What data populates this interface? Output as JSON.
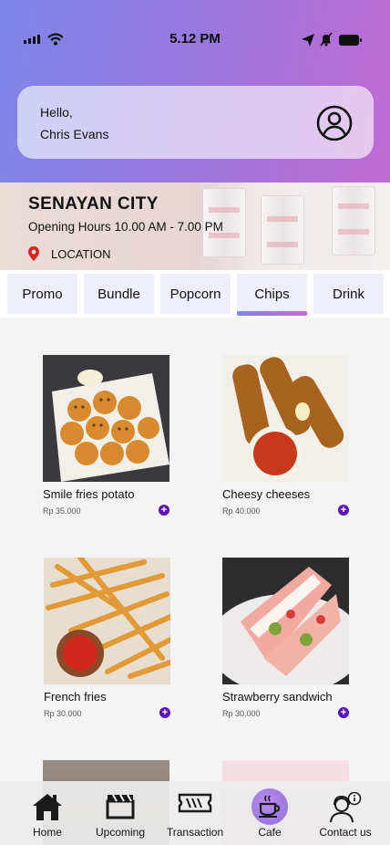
{
  "status_bar": {
    "time": "5.12 PM"
  },
  "greeting": {
    "line1": "Hello,",
    "line2": "Chris Evans"
  },
  "store": {
    "name": "SENAYAN CITY",
    "hours": "Opening Hours 10.00 AM - 7.00 PM",
    "location_label": "LOCATION"
  },
  "tabs": [
    {
      "label": "Promo"
    },
    {
      "label": "Bundle"
    },
    {
      "label": "Popcorn"
    },
    {
      "label": "Chips",
      "active": true
    },
    {
      "label": "Drink"
    }
  ],
  "products": [
    {
      "name": "Smile fries potato",
      "price": "Rp 35.000",
      "icon": "smile-fries-photo"
    },
    {
      "name": "Cheesy cheeses",
      "price": "Rp 40.000",
      "icon": "mozzarella-sticks-photo"
    },
    {
      "name": "French fries",
      "price": "Rp 30.000",
      "icon": "french-fries-photo"
    },
    {
      "name": "Strawberry sandwich",
      "price": "Rp 30.000",
      "icon": "strawberry-sandwich-photo"
    }
  ],
  "bottom_nav": [
    {
      "label": "Home",
      "icon": "home-icon"
    },
    {
      "label": "Upcoming",
      "icon": "clapperboard-icon"
    },
    {
      "label": "Transaction",
      "icon": "ticket-icon"
    },
    {
      "label": "Cafe",
      "icon": "coffee-cup-icon",
      "active": true
    },
    {
      "label": "Contact us",
      "icon": "support-agent-icon"
    }
  ],
  "colors": {
    "accent": "#5b14b5",
    "header_start": "#7d86e8",
    "header_end": "#c06ad4"
  }
}
